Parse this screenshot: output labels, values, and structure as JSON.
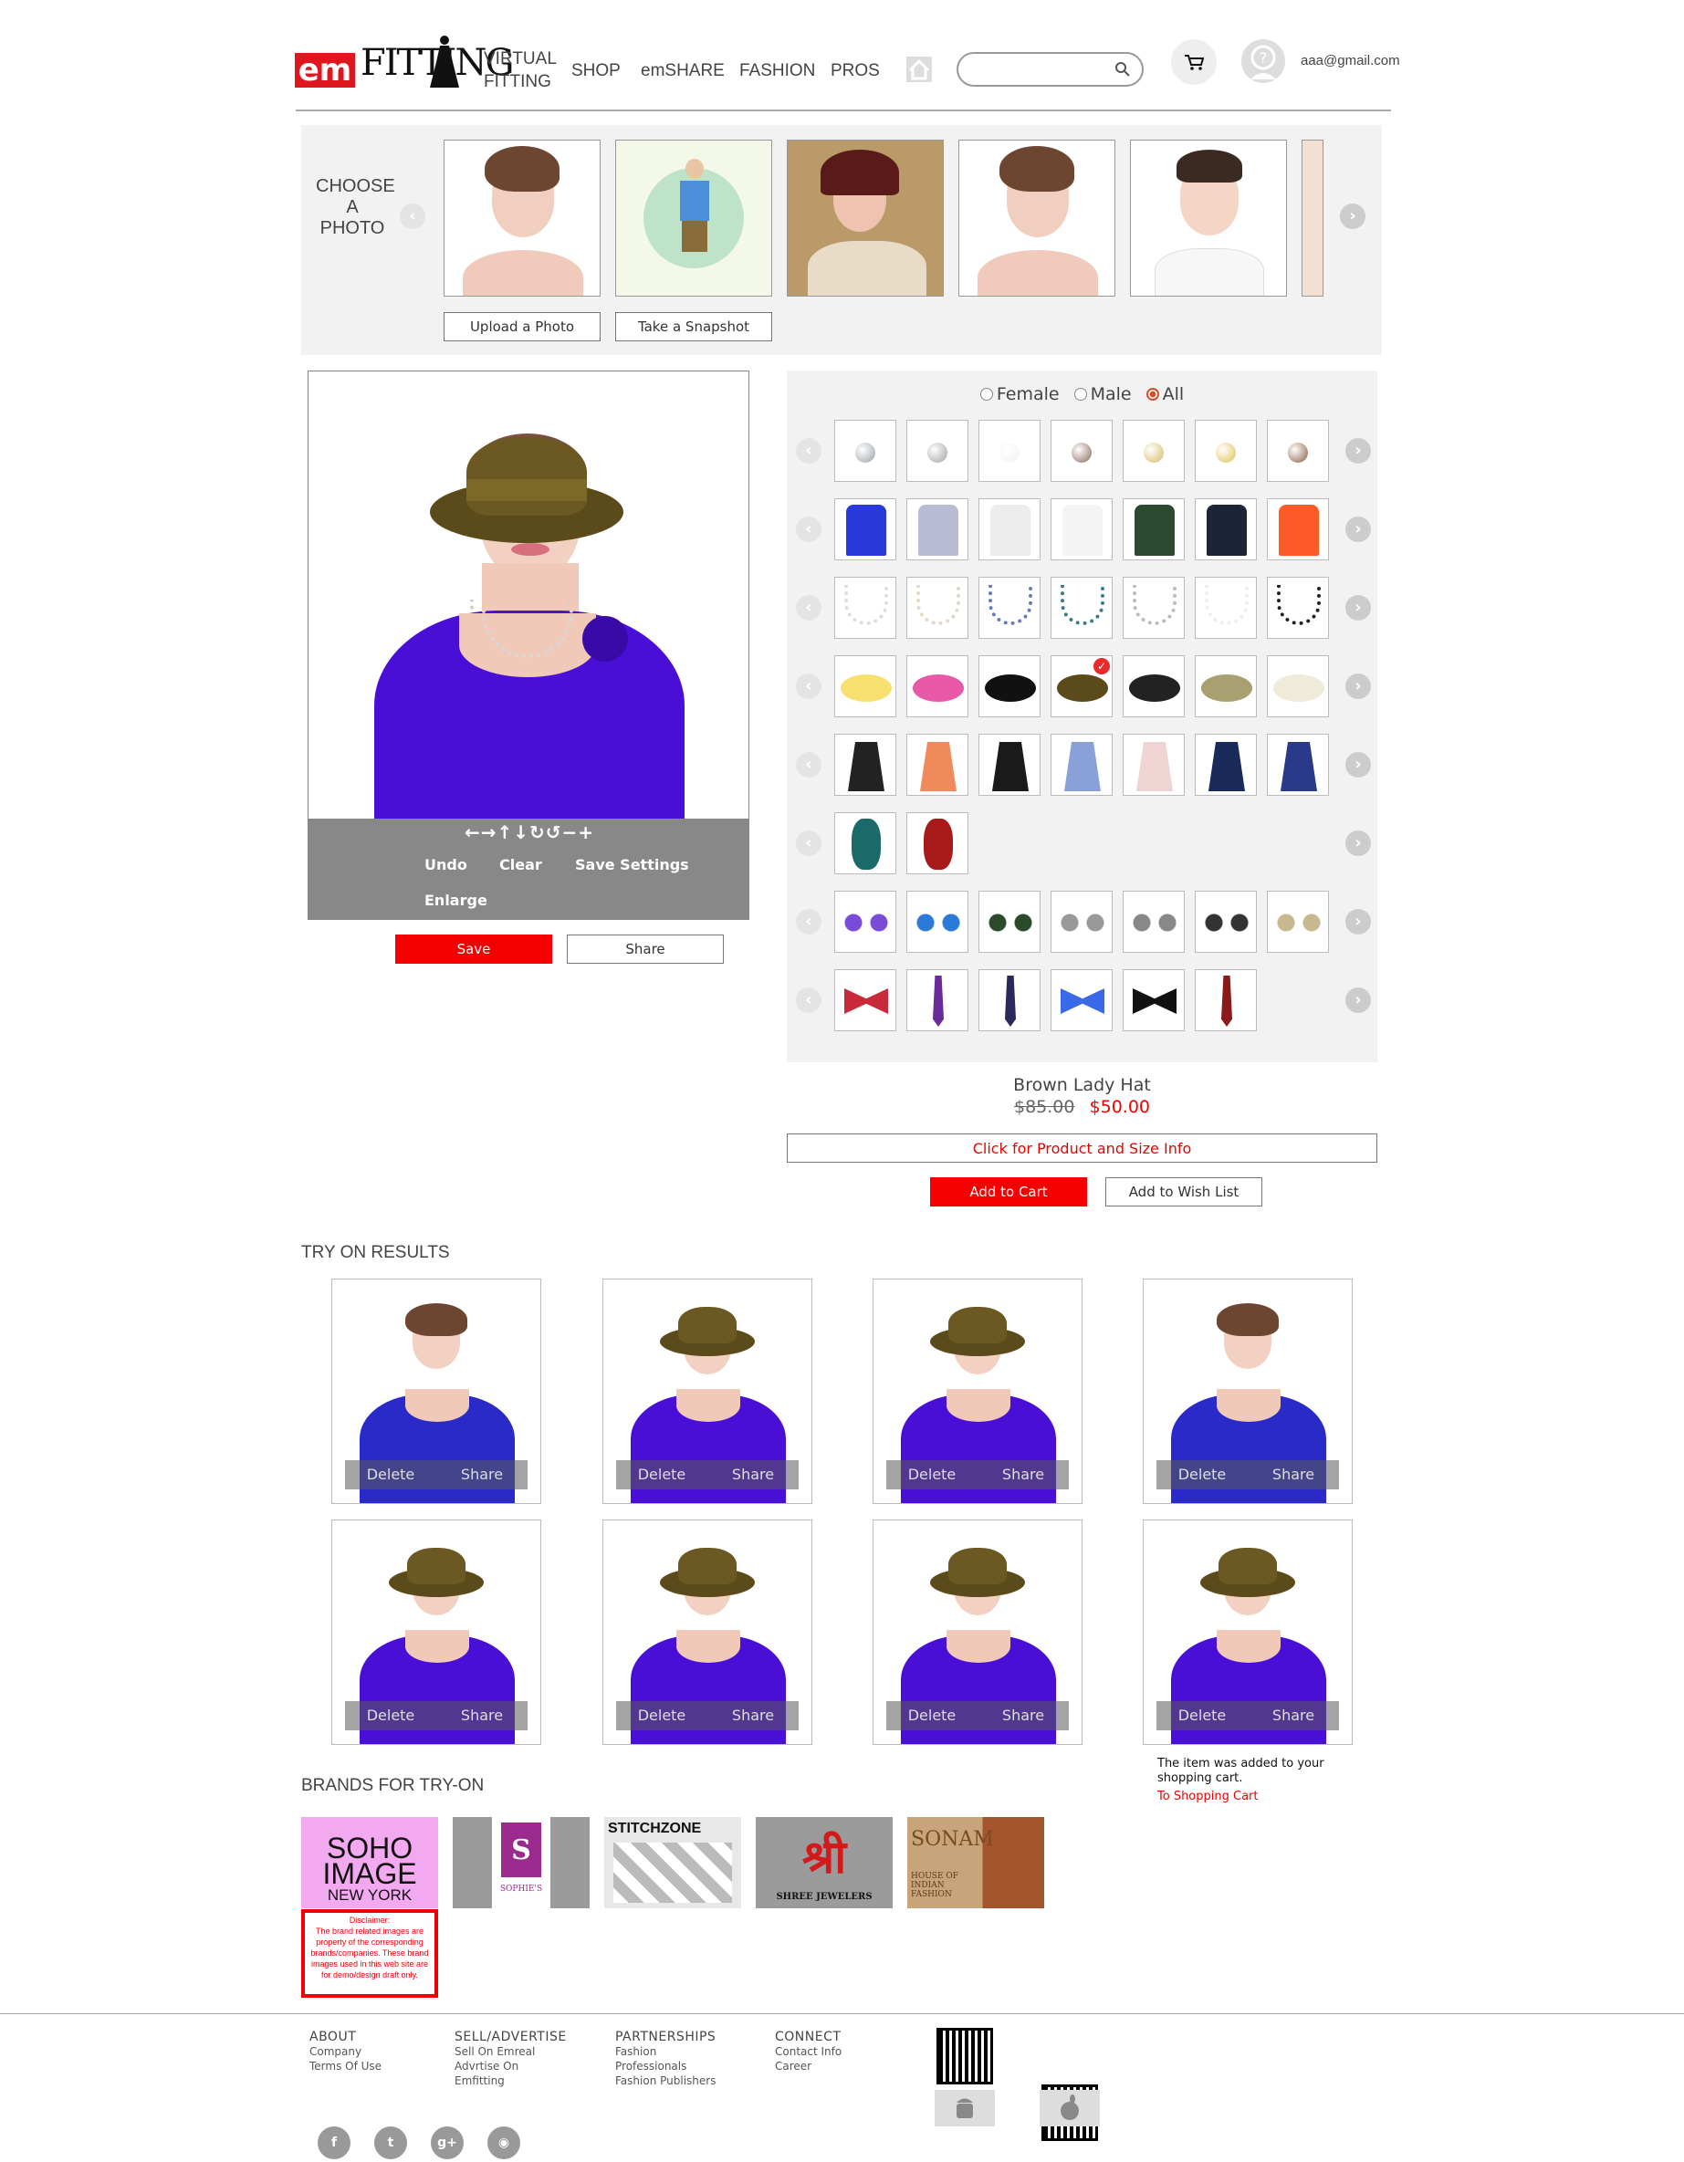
{
  "brand": {
    "em": "em",
    "fitting": "FITTING"
  },
  "nav": {
    "virtual_fitting": "VIRTUAL\nFITTING",
    "shop": "SHOP",
    "emshare": "emSHARE",
    "fashion": "FASHION",
    "pros": "PROS"
  },
  "search": {
    "placeholder": ""
  },
  "user": {
    "email": "aaa@gmail.com"
  },
  "choose": {
    "label": "CHOOSE\nA\nPHOTO",
    "upload_label": "Upload a Photo",
    "snapshot_label": "Take a Snapshot"
  },
  "editor": {
    "controls": "←→↑↓↻↺−+",
    "undo": "Undo",
    "clear": "Clear",
    "save_settings": "Save Settings",
    "enlarge": "Enlarge",
    "save": "Save",
    "share": "Share"
  },
  "filters": {
    "female": "Female",
    "male": "Male",
    "all": "All",
    "selected": "All"
  },
  "product": {
    "name": "Brown Lady Hat",
    "old_price": "$85.00",
    "price": "$50.00",
    "info_link": "Click for Product and Size Info",
    "add_cart": "Add to Cart",
    "wish": "Add to Wish List"
  },
  "results": {
    "title": "TRY ON RESULTS",
    "delete": "Delete",
    "share": "Share",
    "cards": [
      "no-hat",
      "hat",
      "hat",
      "no-hat",
      "hat",
      "hat",
      "hat",
      "hat"
    ],
    "cart_msg": "The item was added to your shopping cart.",
    "cart_link": "To Shopping Cart"
  },
  "brands": {
    "title": "BRANDS FOR TRY-ON",
    "soho": {
      "line1": "SOHO",
      "line2": "IMAGE",
      "line3": "NEW YORK"
    },
    "sophies": "SOPHIE'S",
    "stitchzone": "STITCHZONE",
    "shree": "SHREE JEWELERS",
    "sonam": "SONAM",
    "sonam_sub": "HOUSE OF INDIAN FASHION",
    "disclaimer_title": "Disclaimer:",
    "disclaimer": "The brand related images are property of the corresponding brands/companies. These brand images used in this web site are for demo/design draft only."
  },
  "footer": {
    "about": {
      "title": "ABOUT",
      "items": [
        "Company",
        "Terms Of Use"
      ]
    },
    "sell": {
      "title": "SELL/ADVERTISE",
      "items": [
        "Sell On Emreal",
        "Advrtise On",
        "Emfitting"
      ]
    },
    "partner": {
      "title": "PARTNERSHIPS",
      "items": [
        "Fashion",
        "Professionals",
        "Fashion Publishers"
      ]
    },
    "connect": {
      "title": "CONNECT",
      "items": [
        "Contact Info",
        "Career"
      ]
    }
  },
  "colors": {
    "accent": "#f50000",
    "purple": "#4a0fd6",
    "hat": "#5b4a1a"
  }
}
